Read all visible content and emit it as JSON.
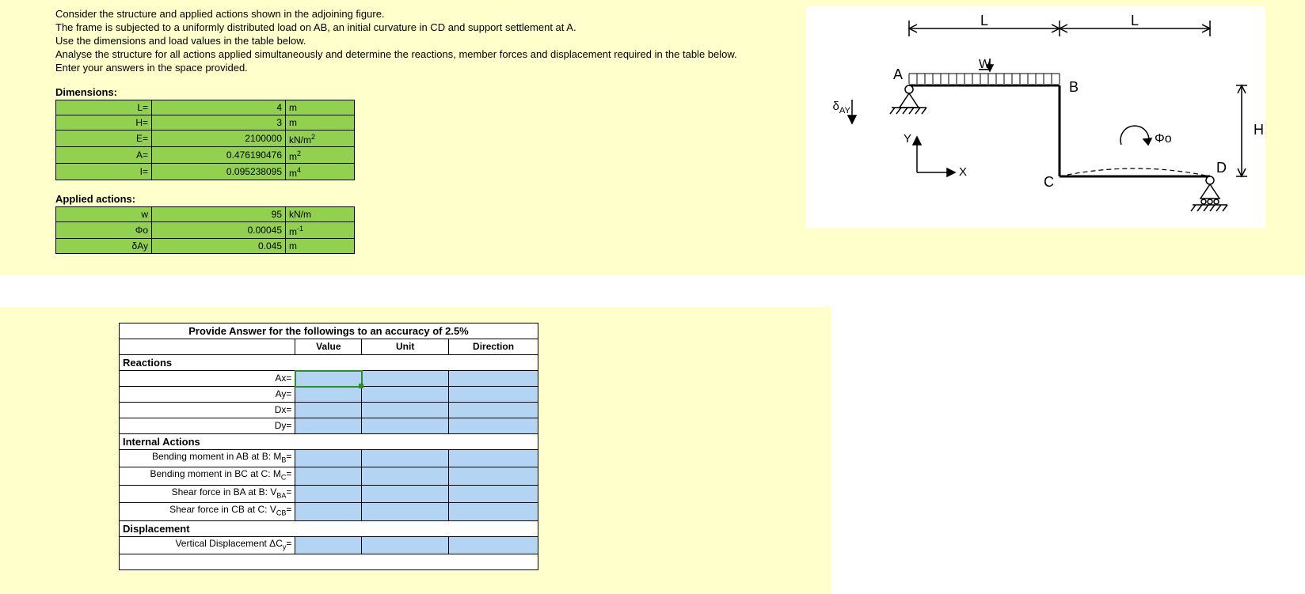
{
  "instructions": {
    "l1": "Consider the structure and applied actions shown in the adjoining figure.",
    "l2": "The frame is subjected to a  uniformly distributed load on AB, an initial curvature in CD and support settlement at A.",
    "l3": "Use the dimensions and load values in the table below.",
    "l4": "Analyse the structure for all actions applied simultaneously and determine the reactions, member forces and displacement required in the table below.",
    "l5": "Enter your answers in the space provided."
  },
  "dimensions_label": "Dimensions:",
  "dimensions": {
    "rows": [
      {
        "label": "L=",
        "value": "4",
        "unit": "m"
      },
      {
        "label": "H=",
        "value": "3",
        "unit": "m"
      },
      {
        "label": "E=",
        "value": "2100000",
        "unit_html": "kN/m<sup>2</sup>"
      },
      {
        "label": "A=",
        "value": "0.476190476",
        "unit_html": "m<sup>2</sup>"
      },
      {
        "label": "I=",
        "value": "0.095238095",
        "unit_html": "m<sup>4</sup>"
      }
    ]
  },
  "actions_label": "Applied actions:",
  "actions": {
    "rows": [
      {
        "label": "w",
        "value": "95",
        "unit": "kN/m"
      },
      {
        "label_html": "Φo",
        "value": "0.00045",
        "unit_html": "m<sup>-1</sup>"
      },
      {
        "label_html": "δAy",
        "value": "0.045",
        "unit": "m"
      }
    ]
  },
  "answer": {
    "title": "Provide Answer for the followings to an accuracy of 2.5%",
    "cols": {
      "value": "Value",
      "unit": "Unit",
      "dir": "Direction"
    },
    "sections": {
      "reactions": "Reactions",
      "internal": "Internal Actions",
      "disp": "Displacement"
    },
    "rows": {
      "ax": "Ax=",
      "ay": "Ay=",
      "dx": "Dx=",
      "dy": "Dy=",
      "mb_html": "Bending moment in AB at B: M<sub>B</sub>=",
      "mc_html": "Bending moment in BC at C: M<sub>C</sub>=",
      "vba_html": "Shear force in BA at B: V<sub>BA</sub>=",
      "vcb_html": "Shear force in CB at C: V<sub>CB</sub>=",
      "dcy_html": "Vertical Displacement ΔC<sub>y</sub>="
    }
  },
  "figure": {
    "labels": {
      "L": "L",
      "A": "A",
      "B": "B",
      "C": "C",
      "D": "D",
      "H": "H",
      "W": "W",
      "X": "X",
      "Y": "Y",
      "phi": "Φo",
      "day_html": "δ<sub>AY</sub>"
    }
  }
}
